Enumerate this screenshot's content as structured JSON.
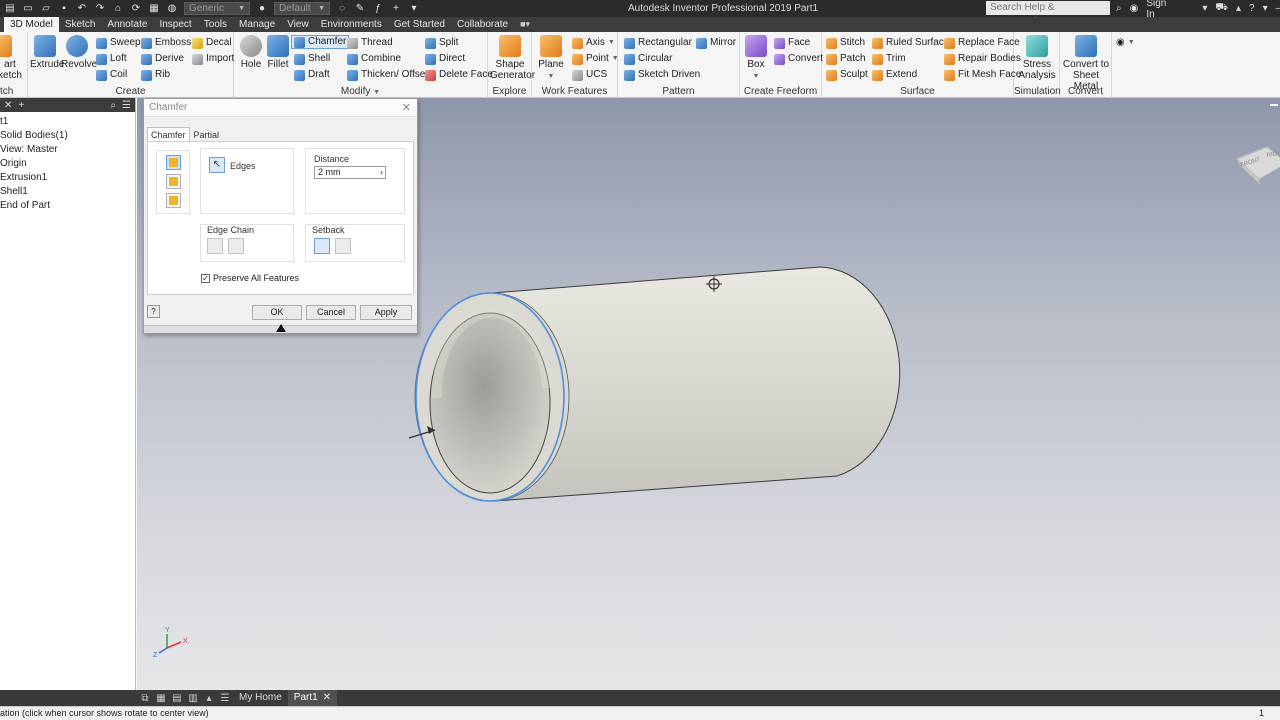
{
  "title_bar": {
    "window_title": "Autodesk Inventor Professional 2019   Part1",
    "appearance_combo": "Generic",
    "material_combo": "Default",
    "search_placeholder": "Search Help & Commands...",
    "sign_in": "Sign In"
  },
  "ribbon_tabs": [
    "3D Model",
    "Sketch",
    "Annotate",
    "Inspect",
    "Tools",
    "Manage",
    "View",
    "Environments",
    "Get Started",
    "Collaborate"
  ],
  "ribbon": {
    "sketch_panel": {
      "start_label": "art\nketch",
      "panel": "tch"
    },
    "create": {
      "label": "Create",
      "extrude": "Extrude",
      "revolve": "Revolve",
      "sweep": "Sweep",
      "loft": "Loft",
      "coil": "Coil",
      "emboss": "Emboss",
      "derive": "Derive",
      "rib": "Rib",
      "decal": "Decal",
      "import": "Import"
    },
    "modify": {
      "label": "Modify",
      "hole": "Hole",
      "fillet": "Fillet",
      "chamfer": "Chamfer",
      "shell": "Shell",
      "draft": "Draft",
      "thread": "Thread",
      "combine": "Combine",
      "thicken": "Thicken/ Offset",
      "split": "Split",
      "direct": "Direct",
      "delete_face": "Delete Face"
    },
    "explore": {
      "label": "Explore",
      "shape_generator": "Shape Generator"
    },
    "work_features": {
      "label": "Work Features",
      "plane": "Plane",
      "axis": "Axis",
      "point": "Point",
      "ucs": "UCS"
    },
    "pattern": {
      "label": "Pattern",
      "rectangular": "Rectangular",
      "circular": "Circular",
      "sketch_driven": "Sketch Driven",
      "mirror": "Mirror"
    },
    "create_freeform": {
      "label": "Create Freeform",
      "box": "Box",
      "face": "Face",
      "convert": "Convert"
    },
    "surface": {
      "label": "Surface",
      "stitch": "Stitch",
      "patch": "Patch",
      "sculpt": "Sculpt",
      "ruled_surface": "Ruled Surface",
      "trim": "Trim",
      "extend": "Extend",
      "replace_face": "Replace Face",
      "repair_bodies": "Repair Bodies",
      "fit_mesh_face": "Fit Mesh Face"
    },
    "simulation": {
      "label": "Simulation",
      "stress_analysis": "Stress Analysis"
    },
    "convert": {
      "label": "Convert",
      "convert_sheet_metal": "Convert to Sheet Metal"
    }
  },
  "browser": {
    "items": [
      "t1",
      "Solid Bodies(1)",
      "View: Master",
      "Origin",
      "Extrusion1",
      "Shell1",
      "End of Part"
    ]
  },
  "dialog": {
    "title": "Chamfer",
    "tabs": [
      "Chamfer",
      "Partial"
    ],
    "edges_label": "Edges",
    "distance_label": "Distance",
    "distance_value": "2 mm",
    "edge_chain_label": "Edge Chain",
    "setback_label": "Setback",
    "preserve_label": "Preserve All Features",
    "preserve_checked": true,
    "ok": "OK",
    "cancel": "Cancel",
    "apply": "Apply"
  },
  "viewcube": {
    "front": "FRONT",
    "right": "RIGHT"
  },
  "triad": {
    "x": "X",
    "y": "Y",
    "z": "Z"
  },
  "doc_tabs": {
    "home": "My Home",
    "part": "Part1"
  },
  "status": {
    "text": "ation (click when cursor shows rotate to center view)",
    "count": "1"
  }
}
